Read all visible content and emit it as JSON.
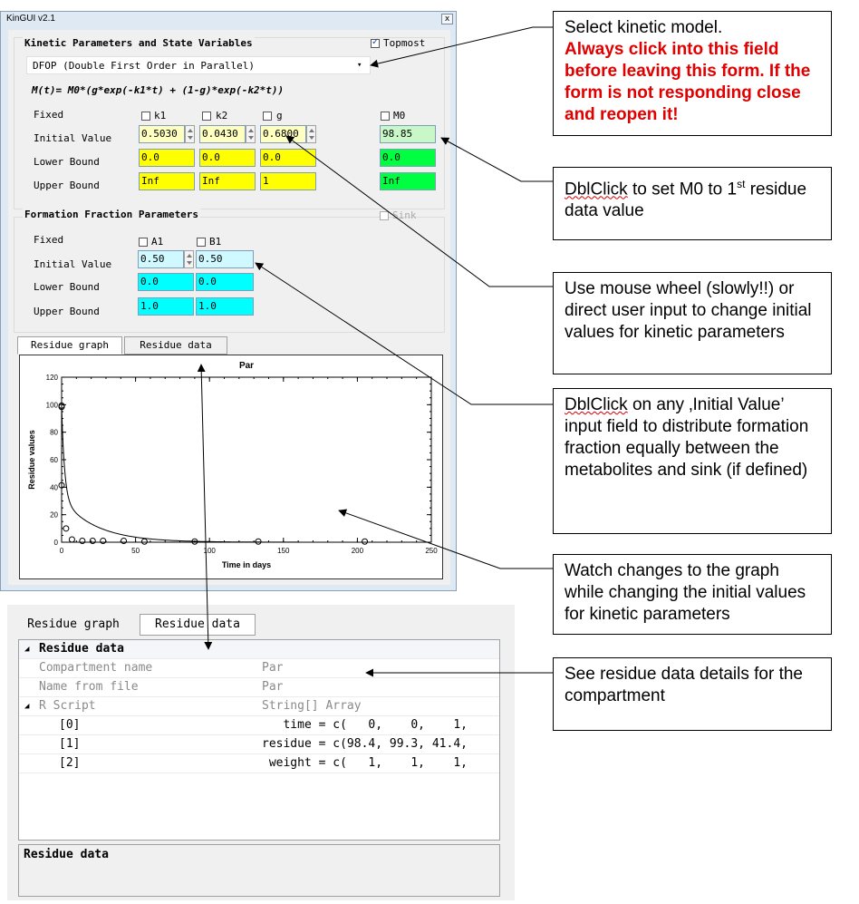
{
  "window": {
    "title": "KinGUI v2.1",
    "close_label": "x"
  },
  "kinetic": {
    "group_title": "Kinetic Parameters and State Variables",
    "topmost_label": "Topmost",
    "topmost_checked": true,
    "model_selected": "DFOP (Double First Order in Parallel)",
    "formula": "M(t)= M0*(g*exp(-k1*t) + (1-g)*exp(-k2*t))",
    "row_labels": [
      "Fixed",
      "Initial Value",
      "Lower Bound",
      "Upper Bound"
    ],
    "params": [
      {
        "name": "k1",
        "initial": "0.5030",
        "lower": "0.0",
        "upper": "Inf"
      },
      {
        "name": "k2",
        "initial": "0.0430",
        "lower": "0.0",
        "upper": "Inf"
      },
      {
        "name": "g",
        "initial": "0.6800",
        "lower": "0.0",
        "upper": "1"
      }
    ],
    "m0": {
      "name": "M0",
      "initial": "98.85",
      "lower": "0.0",
      "upper": "Inf"
    }
  },
  "formation": {
    "group_title": "Formation Fraction Parameters",
    "sink_label": "Sink",
    "row_labels": [
      "Fixed",
      "Initial Value",
      "Lower Bound",
      "Upper Bound"
    ],
    "params": [
      {
        "name": "A1",
        "initial": "0.50",
        "lower": "0.0",
        "upper": "1.0"
      },
      {
        "name": "B1",
        "initial": "0.50",
        "lower": "0.0",
        "upper": "1.0"
      }
    ]
  },
  "tabs_top": {
    "graph": "Residue graph",
    "data": "Residue data"
  },
  "chart_data": {
    "type": "scatter",
    "title": "Par",
    "xlabel": "Time in days",
    "ylabel": "Residue values",
    "xlim": [
      0,
      250
    ],
    "ylim": [
      0,
      120
    ],
    "xticks": [
      "0",
      "50",
      "100",
      "150",
      "200",
      "250"
    ],
    "yticks": [
      "0",
      "20",
      "40",
      "60",
      "80",
      "100",
      "120"
    ],
    "series": [
      {
        "kind": "points",
        "x": [
          0,
          0,
          0,
          3,
          7,
          14,
          21,
          28,
          42,
          56,
          90,
          133,
          205
        ],
        "y": [
          98.4,
          99.3,
          41.4,
          10,
          2,
          1,
          1,
          1,
          1,
          0.5,
          0.5,
          0.5,
          0.5
        ]
      },
      {
        "kind": "fit_line",
        "model": "DFOP",
        "M0": 98.85,
        "k1": 0.503,
        "k2": 0.043,
        "g": 0.68
      }
    ],
    "grid": false
  },
  "lower_panel": {
    "tabs": {
      "graph": "Residue graph",
      "data": "Residue data"
    },
    "rows": [
      {
        "kind": "category",
        "expander": "◢",
        "name": "Residue data",
        "value": ""
      },
      {
        "kind": "prop",
        "name": "Compartment name",
        "value": "Par"
      },
      {
        "kind": "prop",
        "name": "Name from file",
        "value": "Par"
      },
      {
        "kind": "category2",
        "expander": "◢",
        "name": "R Script",
        "value": "String[] Array"
      },
      {
        "kind": "sub",
        "name": "[0]",
        "value": "   time = c(   0,    0,    1,"
      },
      {
        "kind": "sub",
        "name": "[1]",
        "value": "residue = c(98.4, 99.3, 41.4,"
      },
      {
        "kind": "sub",
        "name": "[2]",
        "value": " weight = c(   1,    1,    1,"
      }
    ],
    "description_title": "Residue data"
  },
  "callouts": {
    "model": {
      "line1": "Select kinetic model.",
      "line2": "Always click into this field before leaving this form. If the form is not responding close and reopen it!"
    },
    "m0": {
      "link": "DblClick",
      "text": " to set M0 to 1",
      "sup": "st",
      "text2": " residue data value"
    },
    "wheel": {
      "text": "Use mouse wheel (slowly!!) or direct user input to change initial values for kinetic parameters"
    },
    "ff": {
      "link": "DblClick",
      "text": " on any ‚Initial Value’ input field to distribute formation fraction equally between the metabolites and sink (if defined)"
    },
    "graph": {
      "text": "Watch changes to the graph while changing the initial values for kinetic parameters"
    },
    "data": {
      "text": "See residue data details for the compartment"
    }
  }
}
